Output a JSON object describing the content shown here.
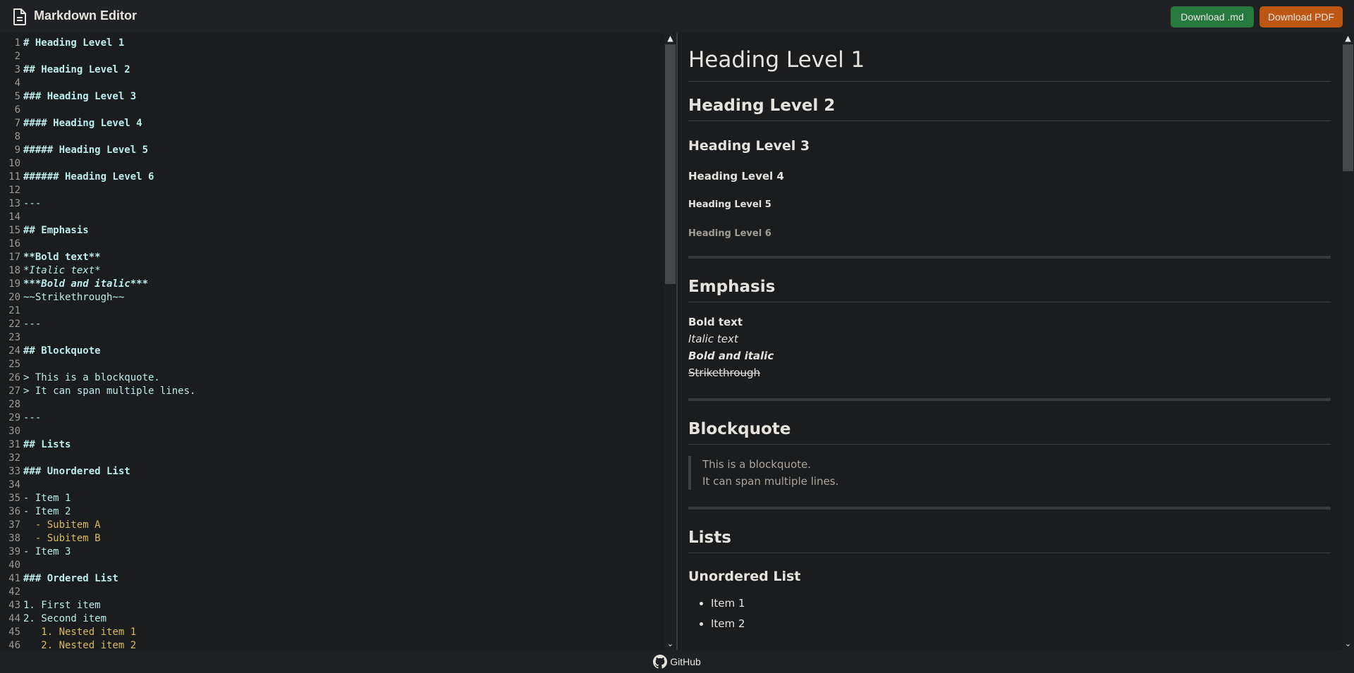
{
  "header": {
    "title": "Markdown Editor",
    "download_md": "Download .md",
    "download_pdf": "Download PDF"
  },
  "colors": {
    "green": "#267a3e",
    "orange": "#bd5713",
    "code": "#bcecea",
    "nested": "#d8bb62"
  },
  "editor": {
    "lines": [
      {
        "n": "1",
        "t": "# Heading Level 1",
        "s": "h"
      },
      {
        "n": "2",
        "t": "",
        "s": ""
      },
      {
        "n": "3",
        "t": "## Heading Level 2",
        "s": "h"
      },
      {
        "n": "4",
        "t": "",
        "s": ""
      },
      {
        "n": "5",
        "t": "### Heading Level 3",
        "s": "h"
      },
      {
        "n": "6",
        "t": "",
        "s": ""
      },
      {
        "n": "7",
        "t": "#### Heading Level 4",
        "s": "h"
      },
      {
        "n": "8",
        "t": "",
        "s": ""
      },
      {
        "n": "9",
        "t": "##### Heading Level 5",
        "s": "h"
      },
      {
        "n": "10",
        "t": "",
        "s": ""
      },
      {
        "n": "11",
        "t": "###### Heading Level 6",
        "s": "h"
      },
      {
        "n": "12",
        "t": "",
        "s": ""
      },
      {
        "n": "13",
        "t": "---",
        "s": ""
      },
      {
        "n": "14",
        "t": "",
        "s": ""
      },
      {
        "n": "15",
        "t": "## Emphasis",
        "s": "h"
      },
      {
        "n": "16",
        "t": "",
        "s": ""
      },
      {
        "n": "17",
        "t": "**Bold text**",
        "s": "b"
      },
      {
        "n": "18",
        "t": "*Italic text*",
        "s": "i"
      },
      {
        "n": "19",
        "t": "***Bold and italic***",
        "s": "bi"
      },
      {
        "n": "20",
        "t": "~~Strikethrough~~",
        "s": ""
      },
      {
        "n": "21",
        "t": "",
        "s": ""
      },
      {
        "n": "22",
        "t": "---",
        "s": ""
      },
      {
        "n": "23",
        "t": "",
        "s": ""
      },
      {
        "n": "24",
        "t": "## Blockquote",
        "s": "h"
      },
      {
        "n": "25",
        "t": "",
        "s": ""
      },
      {
        "n": "26",
        "t": "> This is a blockquote.",
        "s": ""
      },
      {
        "n": "27",
        "t": "> It can span multiple lines.",
        "s": ""
      },
      {
        "n": "28",
        "t": "",
        "s": ""
      },
      {
        "n": "29",
        "t": "---",
        "s": ""
      },
      {
        "n": "30",
        "t": "",
        "s": ""
      },
      {
        "n": "31",
        "t": "## Lists",
        "s": "h"
      },
      {
        "n": "32",
        "t": "",
        "s": ""
      },
      {
        "n": "33",
        "t": "### Unordered List",
        "s": "h"
      },
      {
        "n": "34",
        "t": "",
        "s": ""
      },
      {
        "n": "35",
        "t": "- Item 1",
        "s": ""
      },
      {
        "n": "36",
        "t": "- Item 2",
        "s": ""
      },
      {
        "n": "37",
        "t": "  - Subitem A",
        "s": "n"
      },
      {
        "n": "38",
        "t": "  - Subitem B",
        "s": "n"
      },
      {
        "n": "39",
        "t": "- Item 3",
        "s": ""
      },
      {
        "n": "40",
        "t": "",
        "s": ""
      },
      {
        "n": "41",
        "t": "### Ordered List",
        "s": "h"
      },
      {
        "n": "42",
        "t": "",
        "s": ""
      },
      {
        "n": "43",
        "t": "1. First item",
        "s": ""
      },
      {
        "n": "44",
        "t": "2. Second item",
        "s": ""
      },
      {
        "n": "45",
        "t": "   1. Nested item 1",
        "s": "n"
      },
      {
        "n": "46",
        "t": "   2. Nested item 2",
        "s": "n"
      }
    ]
  },
  "preview": {
    "h1": "Heading Level 1",
    "h2": "Heading Level 2",
    "h3": "Heading Level 3",
    "h4": "Heading Level 4",
    "h5": "Heading Level 5",
    "h6": "Heading Level 6",
    "emphasis_heading": "Emphasis",
    "bold": "Bold text",
    "italic": "Italic text",
    "bold_italic": "Bold and italic",
    "strike": "Strikethrough",
    "blockquote_heading": "Blockquote",
    "quote_line1": "This is a blockquote.",
    "quote_line2": "It can span multiple lines.",
    "lists_heading": "Lists",
    "unordered_heading": "Unordered List",
    "items": [
      "Item 1",
      "Item 2"
    ]
  },
  "footer": {
    "github": "GitHub"
  }
}
